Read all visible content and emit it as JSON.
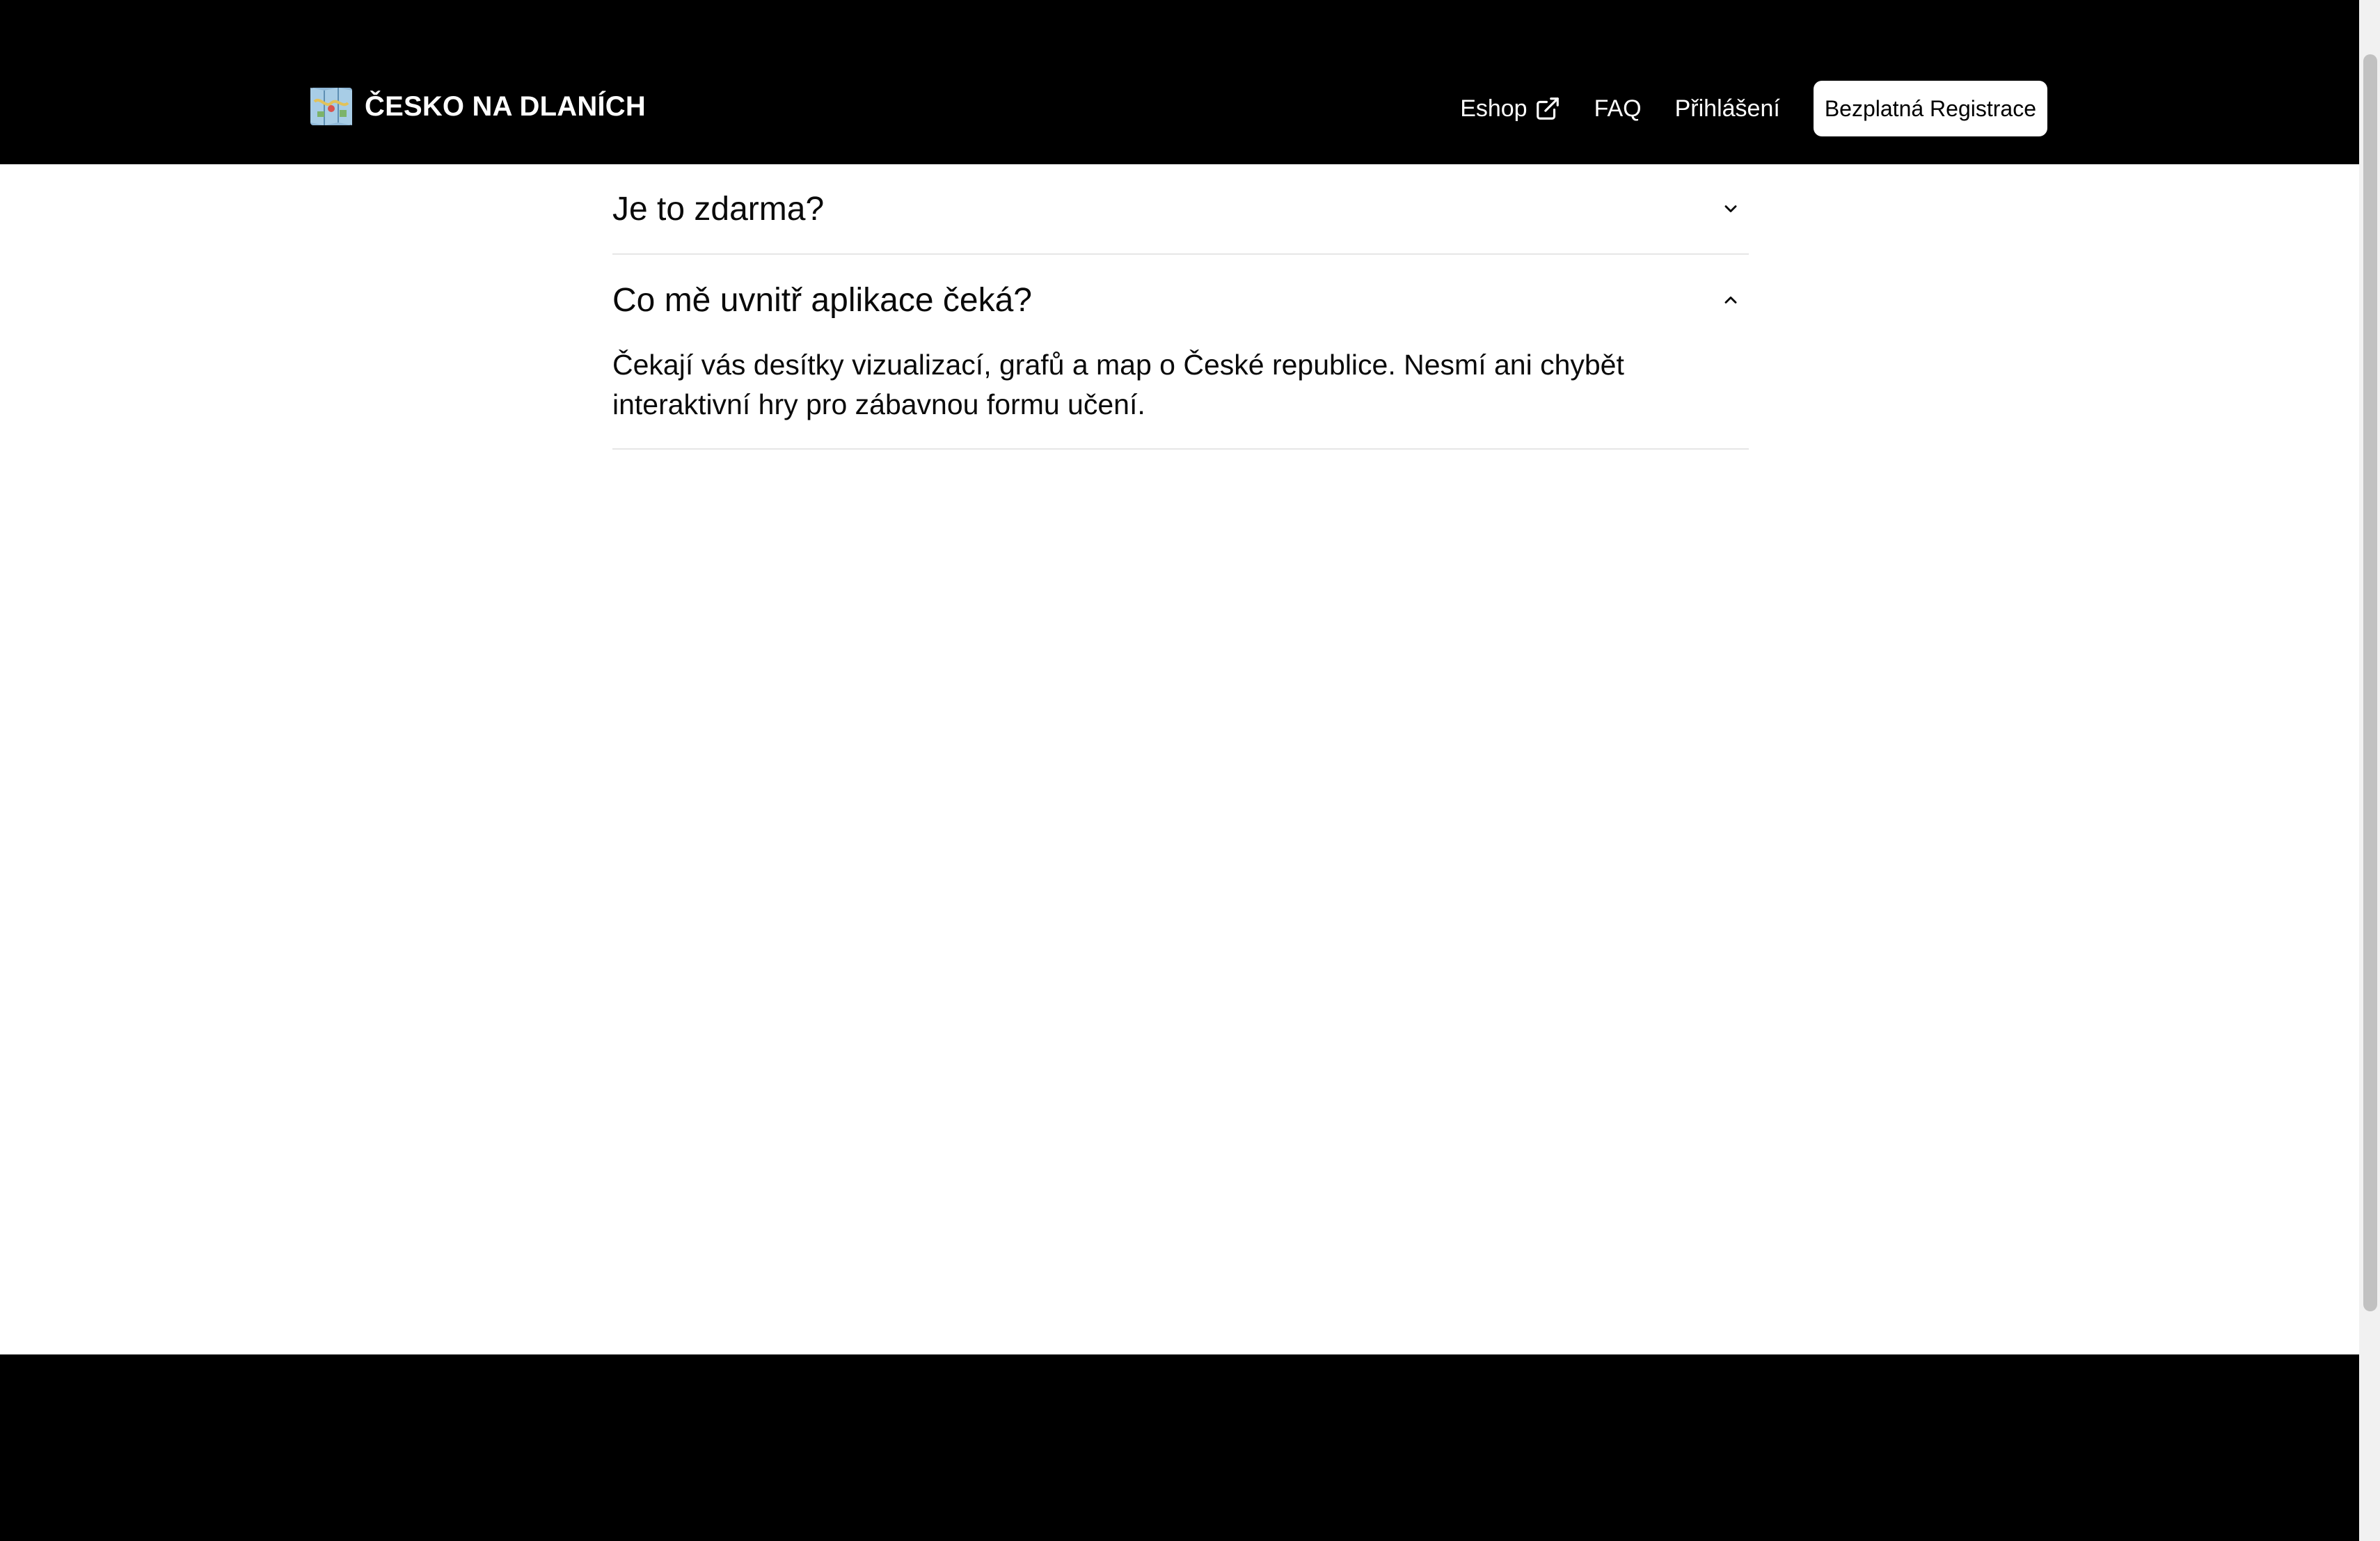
{
  "header": {
    "brand_name": "ČESKO NA DLANÍCH",
    "brand_icon": "map-icon",
    "nav": {
      "eshop": "Eshop",
      "faq": "FAQ",
      "login": "Přihlášení",
      "register": "Bezplatná Registrace"
    }
  },
  "faq": {
    "items": [
      {
        "question": "Je to zdarma?",
        "expanded": false
      },
      {
        "question": "Co mě uvnitř aplikace čeká?",
        "expanded": true,
        "answer": "Čekají vás desítky vizualizací, grafů a map o České republice. Nesmí ani chybět interaktivní hry pro zábavnou formu učení."
      }
    ]
  },
  "colors": {
    "header_bg": "#000000",
    "footer_bg": "#000000",
    "page_bg": "#ffffff",
    "divider": "#e6e6e6"
  }
}
